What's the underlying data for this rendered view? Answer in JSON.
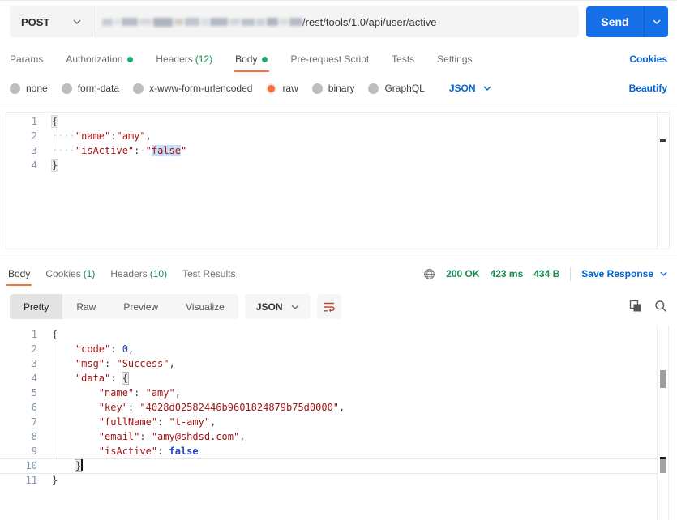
{
  "request": {
    "method": "POST",
    "url_visible": "/rest/tools/1.0/api/user/active",
    "url_redacted": true,
    "send_label": "Send",
    "tabs": [
      {
        "label": "Params"
      },
      {
        "label": "Authorization",
        "dot": true
      },
      {
        "label": "Headers",
        "count": "(12)"
      },
      {
        "label": "Body",
        "dot": true,
        "active": true
      },
      {
        "label": "Pre-request Script"
      },
      {
        "label": "Tests"
      },
      {
        "label": "Settings"
      }
    ],
    "cookies_link": "Cookies",
    "body_modes": [
      "none",
      "form-data",
      "x-www-form-urlencoded",
      "raw",
      "binary",
      "GraphQL"
    ],
    "selected_mode": "raw",
    "content_type": "JSON",
    "beautify_link": "Beautify",
    "body_editor_lines": [
      [
        {
          "t": "{",
          "c": "p hl"
        }
      ],
      [
        {
          "t": "····",
          "c": "ws"
        },
        {
          "t": "\"name\"",
          "c": "k"
        },
        {
          "t": ":",
          "c": "p"
        },
        {
          "t": "\"amy\"",
          "c": "s"
        },
        {
          "t": ",",
          "c": "p"
        }
      ],
      [
        {
          "t": "····",
          "c": "ws"
        },
        {
          "t": "\"isActive\"",
          "c": "k"
        },
        {
          "t": ":",
          "c": "p"
        },
        {
          "t": "·",
          "c": "ws"
        },
        {
          "t": "\"",
          "c": "s"
        },
        {
          "t": "false",
          "c": "s sel-hl"
        },
        {
          "t": "\"",
          "c": "s"
        }
      ],
      [
        {
          "t": "}",
          "c": "p hl"
        }
      ]
    ]
  },
  "response": {
    "tabs": [
      {
        "label": "Body",
        "active": true
      },
      {
        "label": "Cookies",
        "count": "(1)"
      },
      {
        "label": "Headers",
        "count": "(10)"
      },
      {
        "label": "Test Results"
      }
    ],
    "status": "200 OK",
    "time": "423 ms",
    "size": "434 B",
    "save_response": "Save Response",
    "views": [
      "Pretty",
      "Raw",
      "Preview",
      "Visualize"
    ],
    "active_view": "Pretty",
    "format": "JSON",
    "body_editor_lines": [
      [
        {
          "t": "{",
          "c": "p"
        }
      ],
      [
        {
          "t": "    ",
          "c": "p"
        },
        {
          "t": "\"code\"",
          "c": "k"
        },
        {
          "t": ": ",
          "c": "p"
        },
        {
          "t": "0",
          "c": "n"
        },
        {
          "t": ",",
          "c": "p"
        }
      ],
      [
        {
          "t": "    ",
          "c": "p"
        },
        {
          "t": "\"msg\"",
          "c": "k"
        },
        {
          "t": ": ",
          "c": "p"
        },
        {
          "t": "\"Success\"",
          "c": "s"
        },
        {
          "t": ",",
          "c": "p"
        }
      ],
      [
        {
          "t": "    ",
          "c": "p"
        },
        {
          "t": "\"data\"",
          "c": "k"
        },
        {
          "t": ": ",
          "c": "p"
        },
        {
          "t": "{",
          "c": "p box"
        }
      ],
      [
        {
          "t": "        ",
          "c": "p"
        },
        {
          "t": "\"name\"",
          "c": "k"
        },
        {
          "t": ": ",
          "c": "p"
        },
        {
          "t": "\"amy\"",
          "c": "s"
        },
        {
          "t": ",",
          "c": "p"
        }
      ],
      [
        {
          "t": "        ",
          "c": "p"
        },
        {
          "t": "\"key\"",
          "c": "k"
        },
        {
          "t": ": ",
          "c": "p"
        },
        {
          "t": "\"4028d02582446b9601824879b75d0000\"",
          "c": "s"
        },
        {
          "t": ",",
          "c": "p"
        }
      ],
      [
        {
          "t": "        ",
          "c": "p"
        },
        {
          "t": "\"fullName\"",
          "c": "k"
        },
        {
          "t": ": ",
          "c": "p"
        },
        {
          "t": "\"t-amy\"",
          "c": "s"
        },
        {
          "t": ",",
          "c": "p"
        }
      ],
      [
        {
          "t": "        ",
          "c": "p"
        },
        {
          "t": "\"email\"",
          "c": "k"
        },
        {
          "t": ": ",
          "c": "p"
        },
        {
          "t": "\"amy@shdsd.com\"",
          "c": "s"
        },
        {
          "t": ",",
          "c": "p"
        }
      ],
      [
        {
          "t": "        ",
          "c": "p"
        },
        {
          "t": "\"isActive\"",
          "c": "k"
        },
        {
          "t": ": ",
          "c": "p"
        },
        {
          "t": "false",
          "c": "b"
        }
      ],
      [
        {
          "t": "    ",
          "c": "p"
        },
        {
          "t": "}",
          "c": "p box"
        },
        {
          "t": "",
          "c": "cursor"
        }
      ],
      [
        {
          "t": "}",
          "c": "p"
        }
      ]
    ]
  },
  "colors": {
    "accent_orange": "#ff6c37",
    "send_blue": "#1570e8",
    "link_blue": "#0265d2",
    "status_green": "#1d8a55"
  }
}
